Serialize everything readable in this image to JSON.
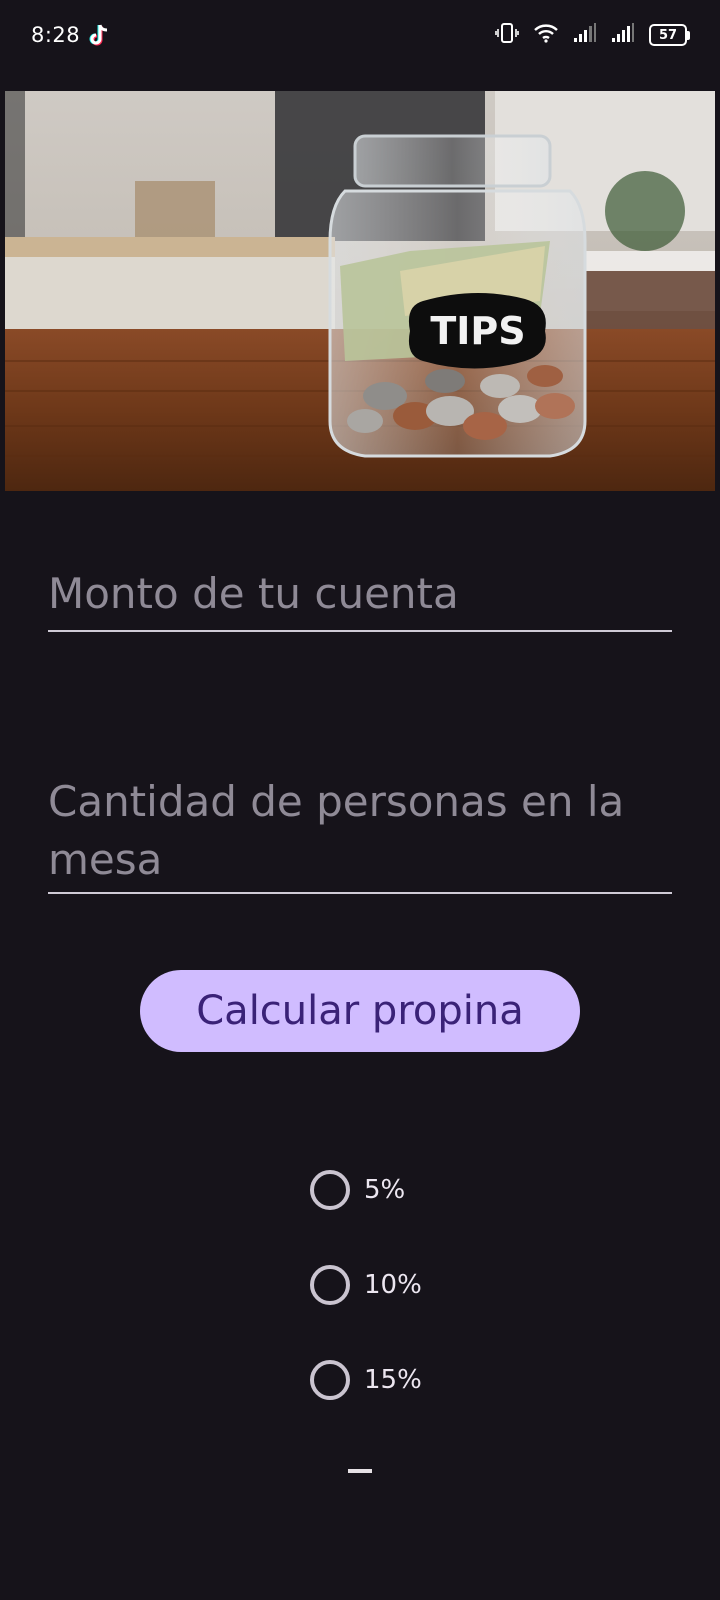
{
  "status_bar": {
    "time": "8:28",
    "battery": "57",
    "icons": [
      "tiktok-icon",
      "vibrate-icon",
      "wifi-icon",
      "signal-icon",
      "signal-icon",
      "battery-icon"
    ]
  },
  "hero": {
    "jar_label": "TIPS"
  },
  "form": {
    "bill_placeholder": "Monto de tu cuenta",
    "people_placeholder": "Cantidad de personas en la mesa"
  },
  "calculate_button": "Calcular propina",
  "tip_options": [
    {
      "label": "5%",
      "selected": false
    },
    {
      "label": "10%",
      "selected": false
    },
    {
      "label": "15%",
      "selected": false
    }
  ],
  "result": "–",
  "colors": {
    "background": "#16131a",
    "button": "#d0bcff",
    "button_text": "#3a2277",
    "placeholder": "#8f8a96"
  }
}
